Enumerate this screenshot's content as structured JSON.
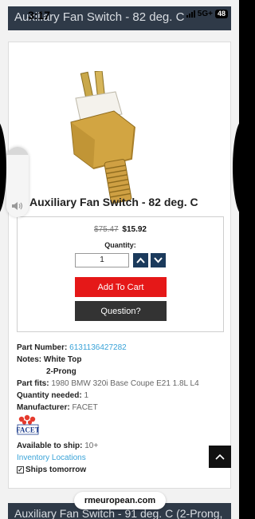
{
  "status_bar": {
    "time": "3:17",
    "network": "5G+",
    "battery": "48"
  },
  "top_header": {
    "title": "Auxiliary Fan Switch - 82 deg. C"
  },
  "product": {
    "name": "Auxiliary Fan Switch - 82 deg. C",
    "image_icon": "fan-switch-product-image"
  },
  "buy_box": {
    "price_old": "$75.47",
    "price_new": "$15.92",
    "quantity_label": "Quantity:",
    "quantity_value": "1",
    "add_to_cart_label": "Add To Cart",
    "question_label": "Question?",
    "add_to_cart_color": "#e51818",
    "question_color": "#333333"
  },
  "specs": {
    "part_number_label": "Part Number:",
    "part_number_value": "6131136427282",
    "notes_label": "Notes:",
    "notes_line1": "White Top",
    "notes_line2": "2-Prong",
    "part_fits_label": "Part fits:",
    "part_fits_value": "1980 BMW 320i Base Coupe E21 1.8L L4",
    "quantity_needed_label": "Quantity needed:",
    "quantity_needed_value": "1",
    "manufacturer_label": "Manufacturer:",
    "manufacturer_value": "FACET",
    "manufacturer_logo_text": "FACET",
    "available_label": "Available to ship:",
    "available_value": "10+",
    "inventory_link": "Inventory Locations",
    "ships_label": "Ships tomorrow",
    "link_color": "#3aa3d8"
  },
  "browser": {
    "domain": "rmeuropean.com"
  },
  "bottom_header": {
    "title": "Auxiliary Fan Switch - 91 deg. C (2-Prong,"
  }
}
